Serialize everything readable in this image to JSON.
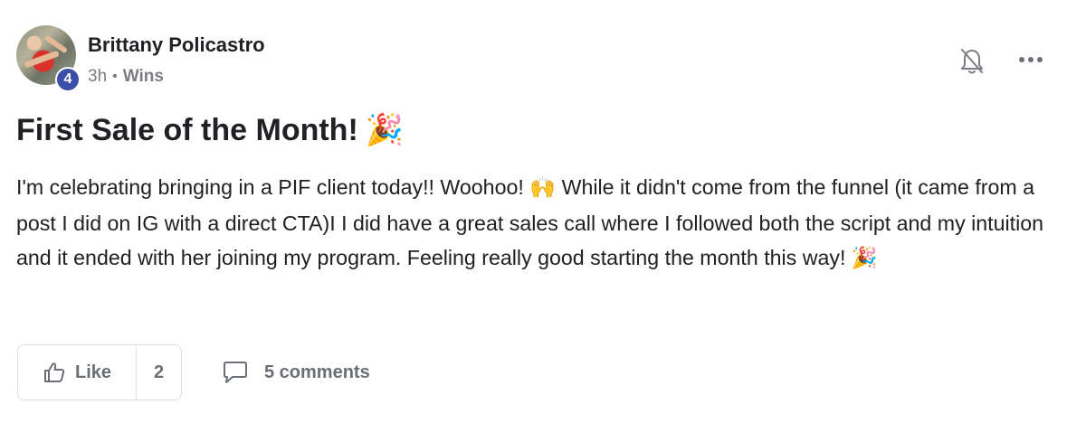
{
  "post": {
    "author": "Brittany Policastro",
    "level": "4",
    "time": "3h",
    "separator": "•",
    "category": "Wins",
    "title": "First Sale of the Month!",
    "title_emoji": "🎉",
    "body_part1": "I'm celebrating bringing in a PIF client today!! Woohoo! ",
    "body_emoji1": "🙌",
    "body_part2": " While it didn't come from the funnel (it came from a post I did on IG with a direct CTA)I I did have a great sales call where I followed both the script and my intuition and it ended with her joining my program. Feeling really good starting the month this way! ",
    "body_emoji2": "🎉"
  },
  "actions": {
    "like_label": "Like",
    "like_count": "2",
    "comments_label": "5 comments"
  },
  "icons": {
    "bell": "bell-off-icon",
    "more": "more-horizontal-icon",
    "like": "thumbs-up-icon",
    "comment": "comment-icon"
  }
}
